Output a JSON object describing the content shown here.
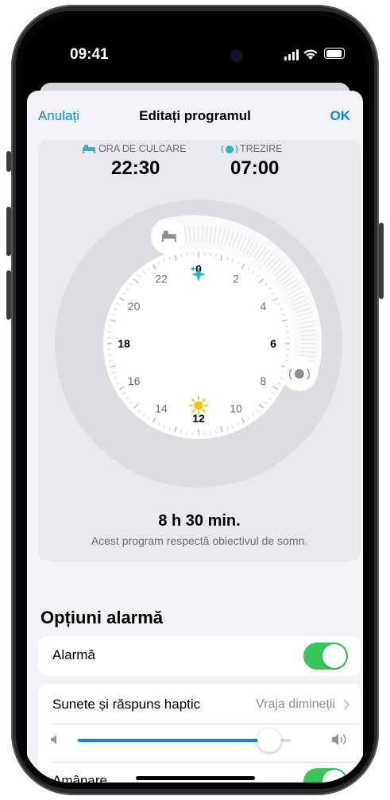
{
  "status_bar": {
    "time": "09:41"
  },
  "nav": {
    "cancel": "Anulați",
    "title": "Editați programul",
    "done": "OK"
  },
  "schedule": {
    "bedtime_label": "ORA DE CULCARE",
    "bedtime_value": "22:30",
    "wake_label": "TREZIRE",
    "wake_value": "07:00"
  },
  "clock": {
    "hour_labels": [
      "0",
      "2",
      "4",
      "6",
      "8",
      "10",
      "12",
      "14",
      "16",
      "18",
      "20",
      "22"
    ],
    "bold_hours": [
      "0",
      "6",
      "12",
      "18"
    ]
  },
  "summary": {
    "duration": "8 h 30 min.",
    "note": "Acest program respectă obiectivul de somn."
  },
  "alarm_options": {
    "title": "Opțiuni alarmă",
    "alarm_label": "Alarmă",
    "alarm_on": true,
    "sounds_label": "Sunete și răspuns haptic",
    "sounds_value": "Vraja dimineții",
    "volume_level": 0.9,
    "snooze_label": "Amânare",
    "snooze_on": true
  },
  "colors": {
    "accent": "#0a84ff",
    "toggle_on": "#34c759",
    "bed_icon": "#2fb5c8",
    "sun": "#ffc400"
  }
}
